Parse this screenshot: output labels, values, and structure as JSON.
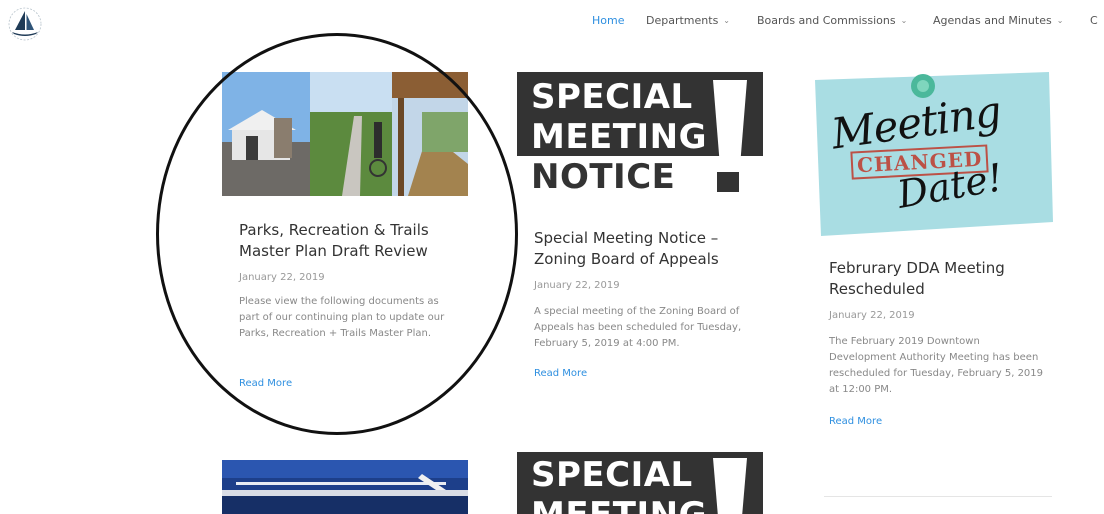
{
  "nav": {
    "items": [
      {
        "label": "Home",
        "active": true,
        "has_dropdown": false
      },
      {
        "label": "Departments",
        "active": false,
        "has_dropdown": true
      },
      {
        "label": "Boards and Commissions",
        "active": false,
        "has_dropdown": true
      },
      {
        "label": "Agendas and Minutes",
        "active": false,
        "has_dropdown": true
      },
      {
        "label": "C",
        "active": false,
        "has_dropdown": false
      }
    ]
  },
  "posts": [
    {
      "title": "Parks, Recreation & Trails Master Plan Draft Review",
      "date": "January 22, 2019",
      "excerpt": "Please view the following documents as part of our continuing plan to update our Parks, Recreation + Trails Master Plan.",
      "read_more": "Read More"
    },
    {
      "image_text": [
        "SPECIAL",
        "MEETING",
        "NOTICE"
      ],
      "title": "Special Meeting Notice – Zoning Board of Appeals",
      "date": "January 22, 2019",
      "excerpt": "A special meeting of the Zoning Board of Appeals has been scheduled for Tuesday, February 5, 2019 at 4:00 PM.",
      "read_more": "Read More"
    },
    {
      "image_text": [
        "Meeting",
        "CHANGED",
        "Date!"
      ],
      "title": "Februrary DDA Meeting Rescheduled",
      "date": "January 22, 2019",
      "excerpt": "The February 2019 Downtown Development Authority Meeting has been rescheduled for Tuesday, February 5, 2019 at 12:00 PM.",
      "read_more": "Read More"
    },
    {
      "image_text": [
        "SPECIAL",
        "MEETING"
      ]
    }
  ],
  "colors": {
    "accent": "#2e8fe0",
    "notice_bg": "#333333",
    "sticky_note": "#a9dde3",
    "stamp_red": "#c0392b"
  },
  "icons": {
    "logo": "sailboat-logo",
    "dropdown": "chevron-down-icon"
  }
}
